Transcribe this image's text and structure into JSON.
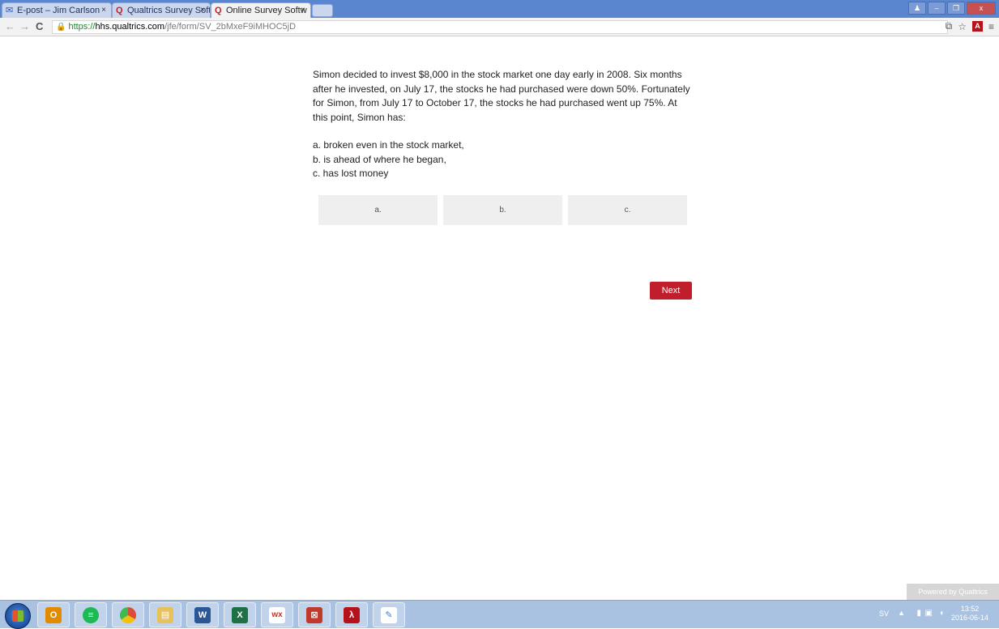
{
  "browser": {
    "tabs": [
      {
        "label": "E-post – Jim Carlson",
        "icon": "mail-icon",
        "active": false
      },
      {
        "label": "Qualtrics Survey Soft",
        "icon": "qualtrics-icon",
        "active": false
      },
      {
        "label": "Online Survey Softw",
        "icon": "qualtrics-icon",
        "active": true
      }
    ],
    "tab_close": "×",
    "url_scheme": "https://",
    "url_host": "hhs.qualtrics.com",
    "url_path": "/jfe/form/SV_2bMxeF9iMHOC5jD",
    "window_controls": [
      "person-icon",
      "minimize-icon",
      "restore-icon",
      "close-icon"
    ]
  },
  "survey": {
    "question_text": "Simon decided to invest $8,000 in the stock market one day early in 2008. Six months after he invested, on July 17, the stocks he had purchased were down 50%. Fortunately for Simon, from July 17 to October 17, the stocks he had purchased went up 75%. At this point, Simon has:",
    "options": [
      "a. broken even in the stock market,",
      "b. is ahead of where he began,",
      "c. has lost money"
    ],
    "choices": [
      "a.",
      "b.",
      "c."
    ],
    "next_label": "Next",
    "powered_by": "Powered by Qualtrics"
  },
  "taskbar": {
    "apps": [
      {
        "name": "outlook",
        "glyph": "O",
        "color": "#e38b00"
      },
      {
        "name": "spotify",
        "glyph": "≡",
        "color": "#1db954"
      },
      {
        "name": "chrome",
        "glyph": "●",
        "color": "#dd4b39"
      },
      {
        "name": "explorer",
        "glyph": "▤",
        "color": "#e7c15a"
      },
      {
        "name": "word",
        "glyph": "W",
        "color": "#2b5797"
      },
      {
        "name": "excel",
        "glyph": "X",
        "color": "#1e7145"
      },
      {
        "name": "wx",
        "glyph": "wx",
        "color": "#c0392b"
      },
      {
        "name": "acrobat-pro",
        "glyph": "A",
        "color": "#c0392b"
      },
      {
        "name": "acrobat-reader",
        "glyph": "λ",
        "color": "#b5121b"
      },
      {
        "name": "paint",
        "glyph": "✎",
        "color": "#3b7dc4"
      }
    ],
    "language": "SV",
    "time": "13:52",
    "date": "2016-06-14"
  }
}
